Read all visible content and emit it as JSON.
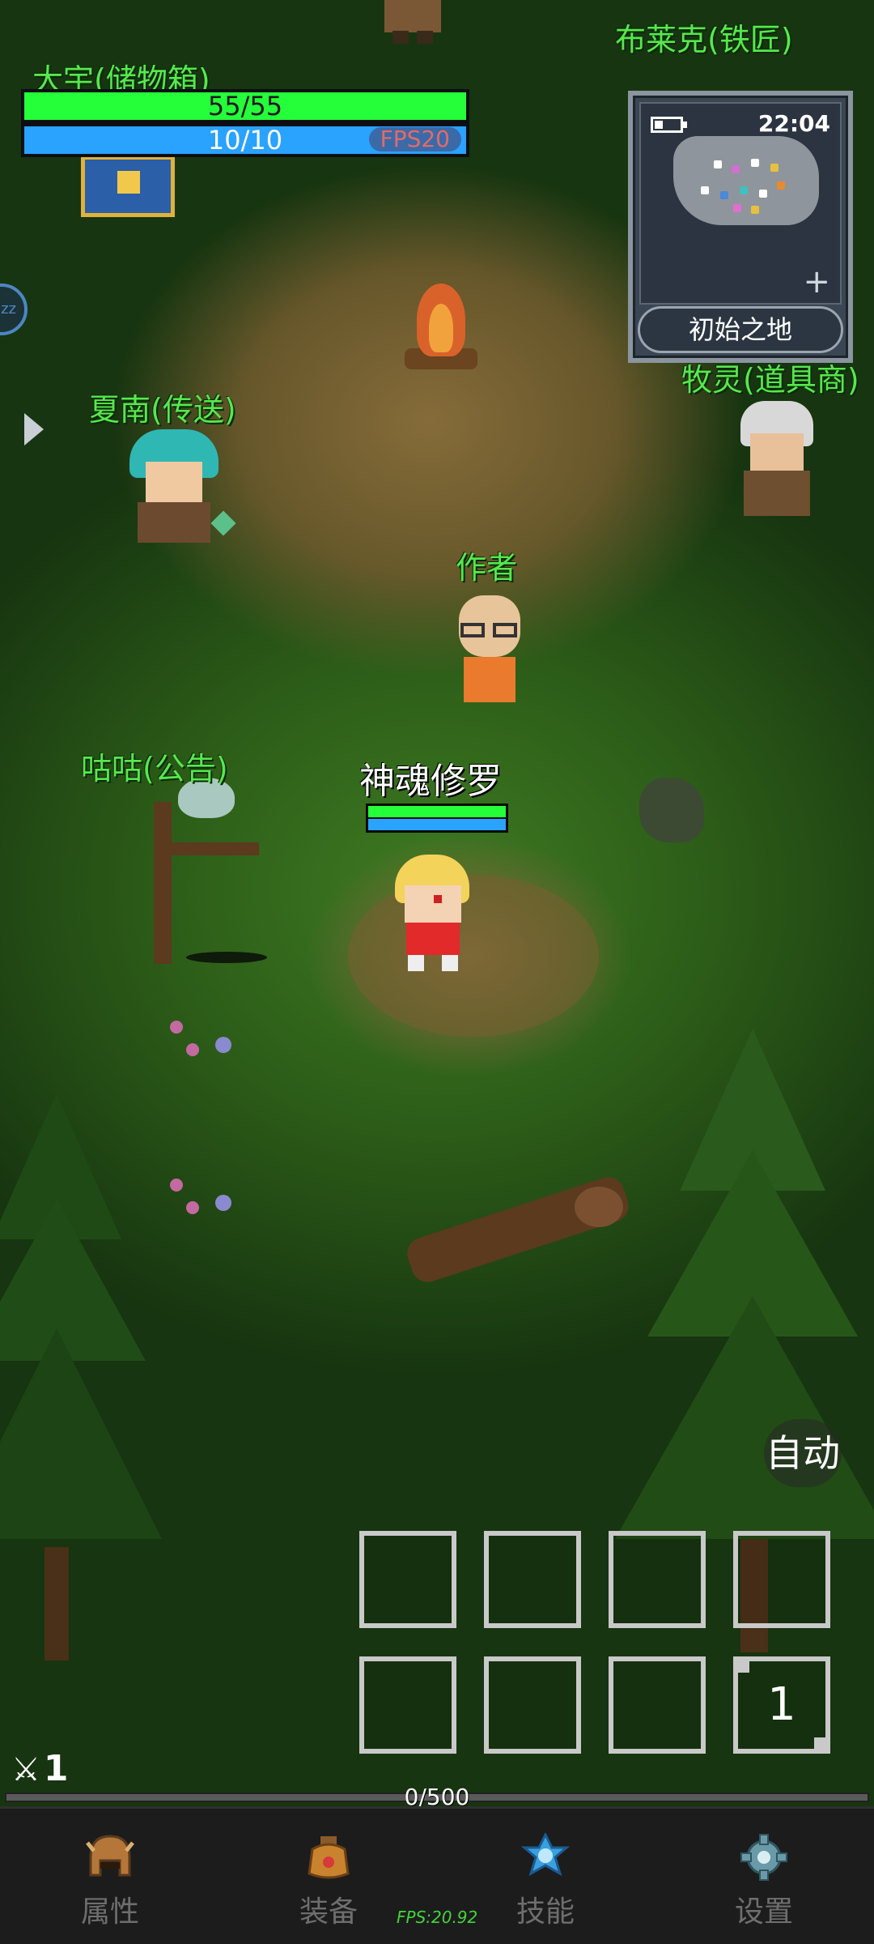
{
  "npcs": {
    "storage": "大宇(储物箱)",
    "blacksmith": "布莱克(铁匠)",
    "teleport": "夏南(传送)",
    "shop": "牧灵(道具商)",
    "author": "作者",
    "notice": "咕咕(公告)"
  },
  "player": {
    "name": "神魂修罗",
    "hp_fraction": 1.0,
    "mp_fraction": 1.0
  },
  "hud": {
    "hp_text": "55/55",
    "hp_fraction": 1.0,
    "mp_text": "10/10",
    "mp_fraction": 1.0,
    "fps_badge": "FPS20"
  },
  "minimap": {
    "time": "22:04",
    "area_name": "初始之地",
    "battery_fraction": 0.3,
    "zoom_icon": "plus-icon"
  },
  "controls": {
    "auto_label": "自动",
    "slot_count_label": "1"
  },
  "status": {
    "level_icon": "sword-icon",
    "level_value": "1",
    "exp_text": "0/500",
    "exp_fraction": 0.0
  },
  "nav": {
    "items": [
      {
        "label": "属性",
        "icon": "helmet-icon"
      },
      {
        "label": "装备",
        "icon": "bag-icon"
      },
      {
        "label": "技能",
        "icon": "skill-gem-icon"
      },
      {
        "label": "设置",
        "icon": "gear-icon"
      }
    ],
    "fps_text": "FPS:20.92"
  },
  "colors": {
    "npc_name": "#57e84d",
    "hp": "#25ff3a",
    "mp": "#2aa2ff",
    "nav_label": "#6e6e6e"
  }
}
